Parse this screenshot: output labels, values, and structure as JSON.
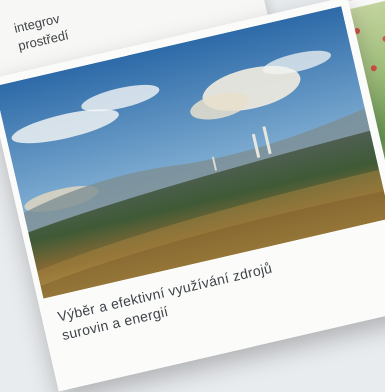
{
  "top_card": {
    "text_line1": "integrov",
    "text_line2": "prostředí"
  },
  "main_card": {
    "caption_line1": "Výběr a efektivní využívání zdrojů",
    "caption_line2": "surovin a energií",
    "photo_label": "landscape-photo"
  },
  "right_card": {
    "label": "map-thumbnail"
  }
}
